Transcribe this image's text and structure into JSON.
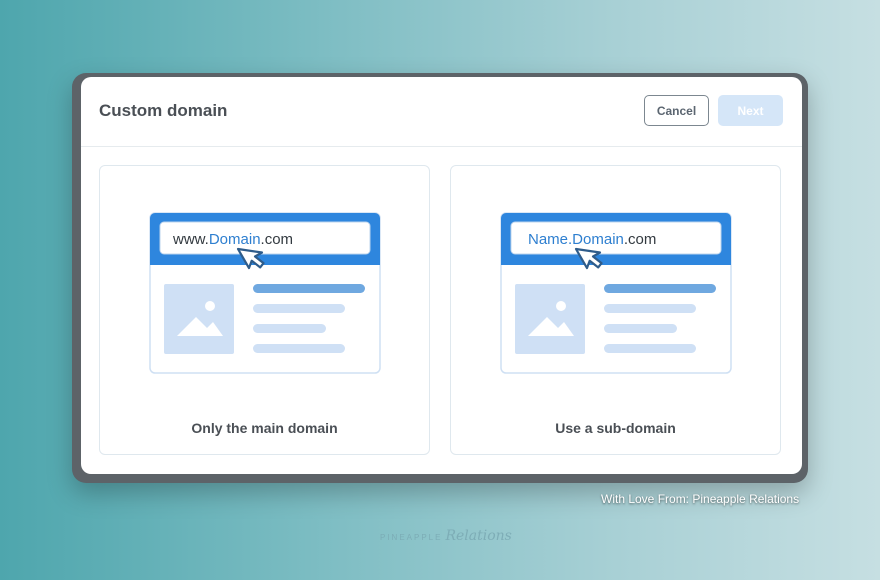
{
  "dialog": {
    "title": "Custom domain",
    "cancel_label": "Cancel",
    "next_label": "Next"
  },
  "options": [
    {
      "url_prefix": "www.",
      "url_highlight": "Domain",
      "url_suffix": ".com",
      "label": "Only the main domain"
    },
    {
      "url_prefix": "",
      "url_highlight": "Name.Domain",
      "url_suffix": ".com",
      "label": "Use a sub-domain"
    }
  ],
  "footer": {
    "credit": "With Love From: Pineapple Relations",
    "brand_main": "PINEAPPLE",
    "brand_script": "Relations"
  },
  "colors": {
    "accent": "#2e86de",
    "highlight_text": "#2e7fd0",
    "next_disabled": "#d5e6f8"
  },
  "icons": [
    "cursor-pointer-icon",
    "image-placeholder-icon"
  ]
}
